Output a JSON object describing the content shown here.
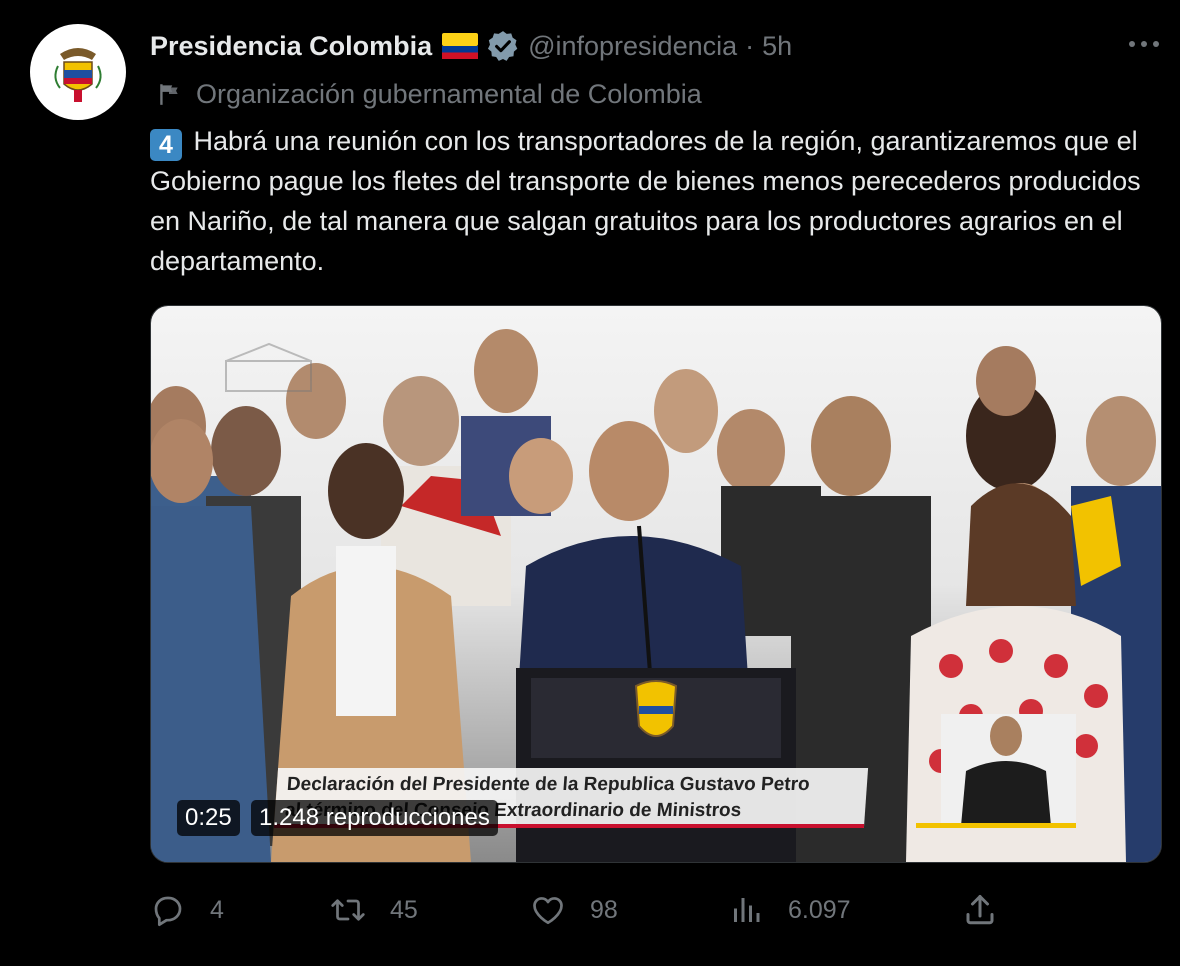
{
  "author": {
    "display_name": "Presidencia Colombia",
    "handle": "@infopresidencia",
    "separator": "·",
    "time_ago": "5h",
    "label": "Organización gubernamental de Colombia",
    "flag_icon": "colombia-flag-emoji",
    "verified_color": "#829aab"
  },
  "tweet": {
    "number_emoji": "4",
    "text": "Habrá una reunión con los transportadores de la región, garantizaremos que el Gobierno pague los fletes del transporte de bienes menos perecederos producidos en Nariño, de tal manera que salgan gratuitos para los productores agrarios en el departamento."
  },
  "media": {
    "overlay_line1": "Declaración del Presidente de la Republica Gustavo Petro",
    "overlay_line2": "al término del Consejo Extraordinario de Ministros",
    "duration": "0:25",
    "views": "1.248 reproducciones"
  },
  "actions": {
    "replies": "4",
    "retweets": "45",
    "likes": "98",
    "views": "6.097"
  },
  "colors": {
    "background": "#000000",
    "text": "#e7e9ea",
    "secondary": "#71767b",
    "keycap": "#3b88c3"
  }
}
